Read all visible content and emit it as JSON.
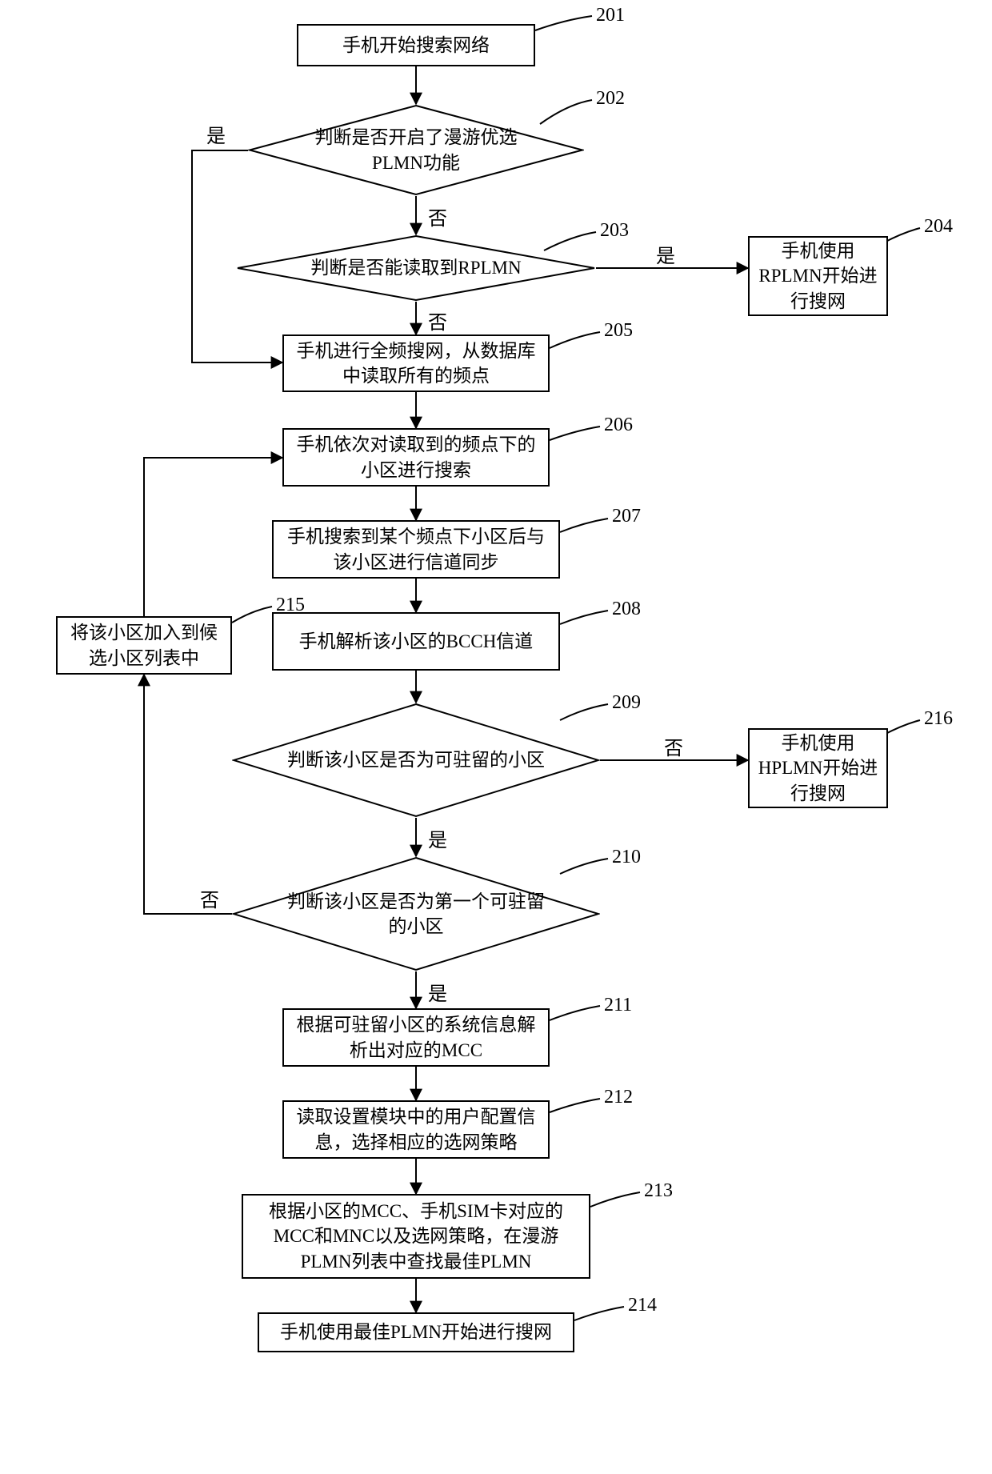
{
  "flow": {
    "steps": {
      "s201": "手机开始搜索网络",
      "s202": "判断是否开启了漫游优选PLMN功能",
      "s203": "判断是否能读取到RPLMN",
      "s204": "手机使用RPLMN开始进行搜网",
      "s205": "手机进行全频搜网，从数据库中读取所有的频点",
      "s206": "手机依次对读取到的频点下的小区进行搜索",
      "s207": "手机搜索到某个频点下小区后与该小区进行信道同步",
      "s208": "手机解析该小区的BCCH信道",
      "s209": "判断该小区是否为可驻留的小区",
      "s210": "判断该小区是否为第一个可驻留的小区",
      "s211": "根据可驻留小区的系统信息解析出对应的MCC",
      "s212": "读取设置模块中的用户配置信息，选择相应的选网策略",
      "s213": "根据小区的MCC、手机SIM卡对应的MCC和MNC以及选网策略，在漫游PLMN列表中查找最佳PLMN",
      "s214": "手机使用最佳PLMN开始进行搜网",
      "s215": "将该小区加入到候选小区列表中",
      "s216": "手机使用HPLMN开始进行搜网"
    },
    "numbers": {
      "n201": "201",
      "n202": "202",
      "n203": "203",
      "n204": "204",
      "n205": "205",
      "n206": "206",
      "n207": "207",
      "n208": "208",
      "n209": "209",
      "n210": "210",
      "n211": "211",
      "n212": "212",
      "n213": "213",
      "n214": "214",
      "n215": "215",
      "n216": "216"
    },
    "labels": {
      "yes": "是",
      "no": "否"
    }
  }
}
